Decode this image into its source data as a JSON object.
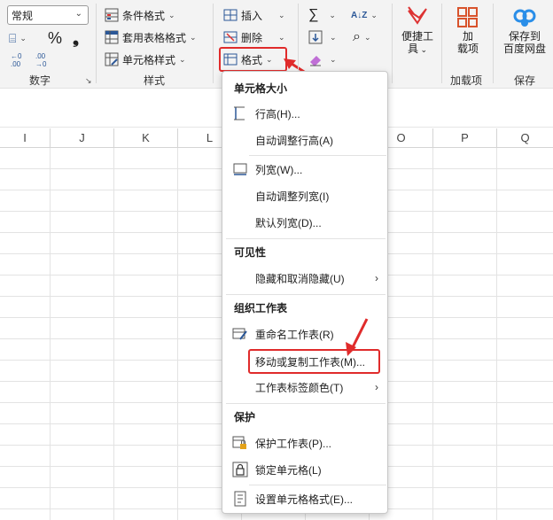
{
  "ribbon": {
    "number_format_value": "常规",
    "currency_glyph": "⌸",
    "percent_glyph": "%",
    "comma_glyph": "❟",
    "inc_decimal_glyph": "←.0 .00",
    "dec_decimal_glyph": ".00 →.0",
    "number_group_label": "数字",
    "conditional_format": "条件格式",
    "table_format": "套用表格格式",
    "cell_styles": "单元格样式",
    "styles_group_label": "样式",
    "insert": "插入",
    "delete": "删除",
    "format": "格式",
    "sum_glyph": "∑",
    "sort_glyph": "A↓Z",
    "find_glyph": "⌕",
    "convenient_tools": "便捷工具",
    "addins": "加载项",
    "addins_line1": "加",
    "addins_line2": "载项",
    "addins_group_label": "加载项",
    "save_to_cloud_line1": "保存到",
    "save_to_cloud_line2": "百度网盘",
    "save_group_label": "保存",
    "convenient_line1": "便捷工",
    "convenient_line2": "具"
  },
  "columns": [
    "I",
    "J",
    "K",
    "L",
    "O",
    "P",
    "Q"
  ],
  "menu": {
    "section_cell_size": "单元格大小",
    "row_height": "行高(H)...",
    "autofit_row": "自动调整行高(A)",
    "col_width": "列宽(W)...",
    "autofit_col": "自动调整列宽(I)",
    "default_width": "默认列宽(D)...",
    "section_visibility": "可见性",
    "hide_unhide": "隐藏和取消隐藏(U)",
    "section_organize": "组织工作表",
    "rename_sheet": "重命名工作表(R)",
    "move_copy": "移动或复制工作表(M)...",
    "tab_color": "工作表标签颜色(T)",
    "section_protect": "保护",
    "protect_sheet": "保护工作表(P)...",
    "lock_cell": "锁定单元格(L)",
    "format_cells": "设置单元格格式(E)..."
  },
  "colors": {
    "highlight_red": "#e02b2b",
    "excel_green": "#1e7145",
    "icon_blue": "#2b5797"
  }
}
